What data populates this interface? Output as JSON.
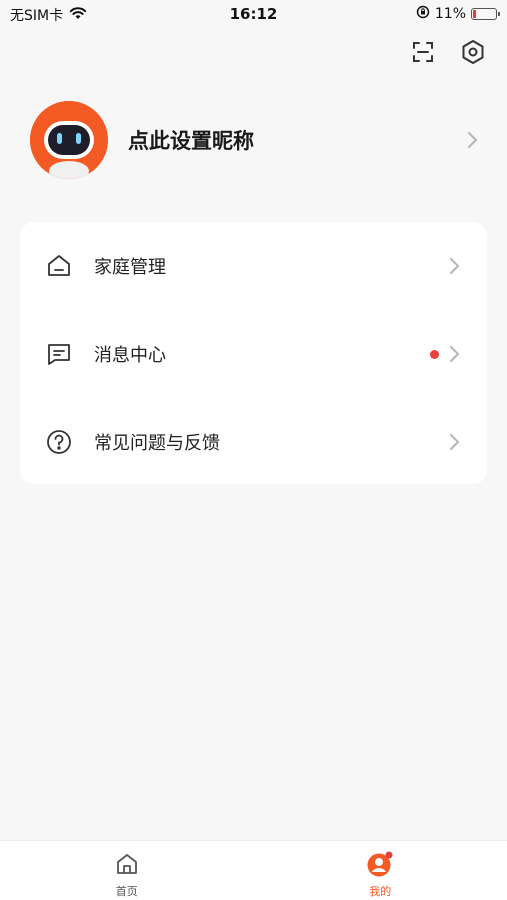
{
  "status_bar": {
    "carrier": "无SIM卡",
    "time": "16:12",
    "battery": "11%"
  },
  "top_actions": {
    "scan_icon": "scan-icon",
    "settings_icon": "settings-icon"
  },
  "profile": {
    "nickname": "点此设置昵称"
  },
  "menu": {
    "items": [
      {
        "label": "家庭管理",
        "icon": "home-icon"
      },
      {
        "label": "消息中心",
        "icon": "message-icon",
        "has_badge": true
      },
      {
        "label": "常见问题与反馈",
        "icon": "help-icon"
      }
    ]
  },
  "tab_bar": {
    "tabs": [
      {
        "label": "首页",
        "icon": "home-tab-icon"
      },
      {
        "label": "我的",
        "icon": "profile-tab-icon",
        "active": true
      }
    ]
  },
  "colors": {
    "accent": "#f45a24",
    "badge": "#e8403a",
    "background": "#f7f7f7"
  }
}
